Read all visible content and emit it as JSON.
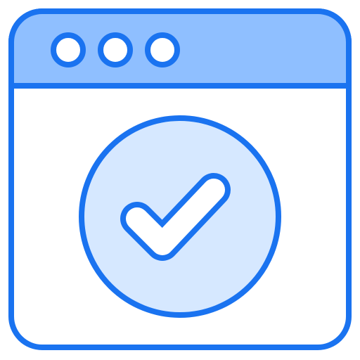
{
  "icon": {
    "name": "browser-window-checkmark-icon",
    "window_controls": [
      "dot",
      "dot",
      "dot"
    ],
    "symbol": "checkmark"
  },
  "colors": {
    "stroke": "#1a73f0",
    "title_bar_fill": "#8fbfff",
    "body_fill": "#ffffff",
    "badge_fill": "#d6e8ff",
    "dot_fill": "#ffffff",
    "check_fill": "#ffffff"
  }
}
